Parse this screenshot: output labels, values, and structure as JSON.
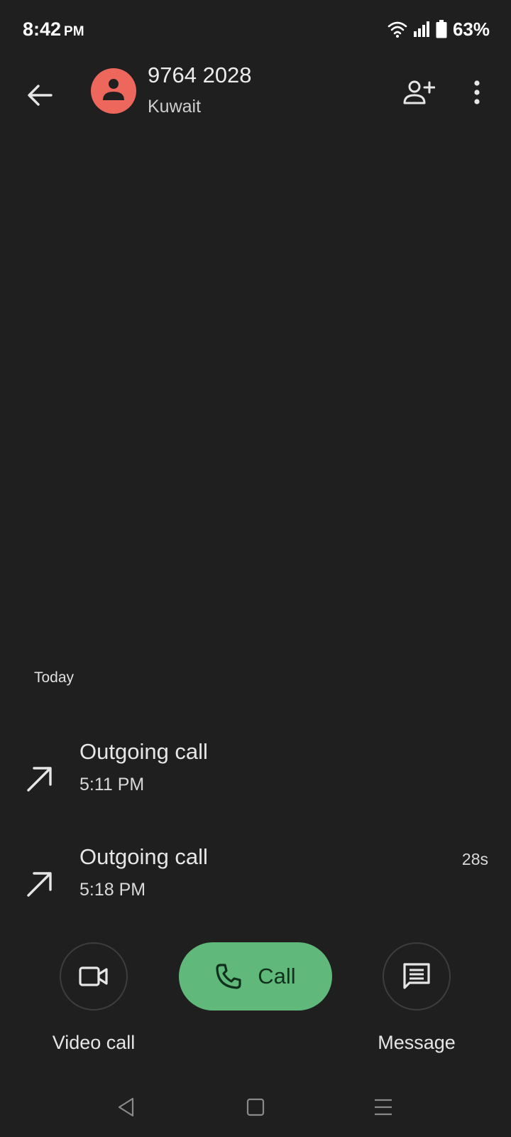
{
  "status_bar": {
    "time": "8:42",
    "ampm": "PM",
    "battery": "63%",
    "icons": [
      "wifi-icon",
      "signal-icon",
      "battery-icon"
    ]
  },
  "app_bar": {
    "back_icon": "arrow-back-icon",
    "avatar_icon": "person-icon",
    "avatar_color": "#ee675c",
    "number": "9764 2028",
    "location": "Kuwait",
    "add_contact_icon": "person-add-icon",
    "more_icon": "more-vert-icon"
  },
  "history": {
    "section_label": "Today",
    "calls": [
      {
        "type": "Outgoing call",
        "time": "5:11 PM",
        "duration": "",
        "icon": "outgoing-arrow-icon"
      },
      {
        "type": "Outgoing call",
        "time": "5:18 PM",
        "duration": "28s",
        "icon": "outgoing-arrow-icon"
      }
    ]
  },
  "actions": {
    "video_call_label": "Video call",
    "call_label": "Call",
    "message_label": "Message",
    "call_color": "#60b97b"
  },
  "nav": {
    "icons": [
      "nav-back-icon",
      "nav-home-icon",
      "nav-recents-icon"
    ]
  }
}
